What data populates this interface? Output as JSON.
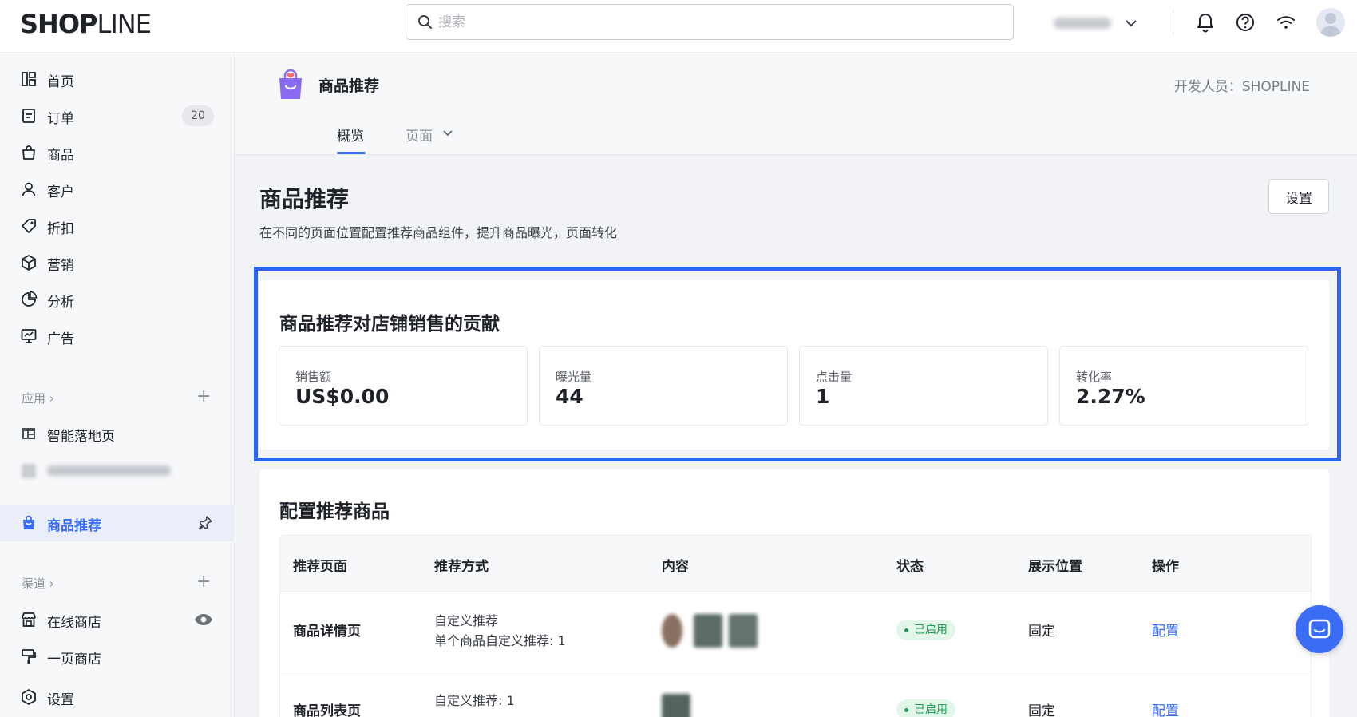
{
  "topbar": {
    "logo_bold": "SHOP",
    "logo_thin": "LINE",
    "search_placeholder": "搜索",
    "icons": [
      "search-icon",
      "chevron-down-icon",
      "bell-icon",
      "help-icon",
      "wifi-icon",
      "avatar"
    ]
  },
  "sidebar": {
    "items": [
      {
        "label": "首页",
        "icon": "home-icon"
      },
      {
        "label": "订单",
        "icon": "order-icon",
        "badge": "20"
      },
      {
        "label": "商品",
        "icon": "bag-icon"
      },
      {
        "label": "客户",
        "icon": "user-icon"
      },
      {
        "label": "折扣",
        "icon": "tag-icon"
      },
      {
        "label": "营销",
        "icon": "cube-icon"
      },
      {
        "label": "分析",
        "icon": "pie-chart-icon"
      },
      {
        "label": "广告",
        "icon": "ad-icon"
      }
    ],
    "apps_title": "应用",
    "apps": [
      {
        "label": "智能落地页",
        "icon": "layout-icon"
      },
      {
        "label": "商品推荐",
        "icon": "gift-bag-icon",
        "active": true
      }
    ],
    "channels_title": "渠道",
    "channels": [
      {
        "label": "在线商店",
        "icon": "store-icon"
      },
      {
        "label": "一页商店",
        "icon": "brush-icon"
      }
    ],
    "settings_label": "设置"
  },
  "app_header": {
    "title": "商品推荐",
    "developer": "开发人员：SHOPLINE",
    "tabs": [
      {
        "label": "概览",
        "active": true
      },
      {
        "label": "页面",
        "dropdown": true
      }
    ]
  },
  "page": {
    "title": "商品推荐",
    "description": "在不同的页面位置配置推荐商品组件，提升商品曝光，页面转化",
    "settings_button": "设置"
  },
  "contribution": {
    "title": "商品推荐对店铺销售的贡献",
    "stats": [
      {
        "label": "销售额",
        "value": "US$0.00"
      },
      {
        "label": "曝光量",
        "value": "44"
      },
      {
        "label": "点击量",
        "value": "1"
      },
      {
        "label": "转化率",
        "value": "2.27%"
      }
    ]
  },
  "config": {
    "title": "配置推荐商品",
    "columns": [
      "推荐页面",
      "推荐方式",
      "内容",
      "状态",
      "展示位置",
      "操作"
    ],
    "rows": [
      {
        "page": "商品详情页",
        "method": "自定义推荐",
        "method_detail": "单个商品自定义推荐: 1",
        "status": "已启用",
        "position": "固定",
        "action": "配置"
      },
      {
        "page": "商品列表页",
        "method": "自定义推荐: 1",
        "method_detail": "",
        "status": "已启用",
        "position": "固定",
        "action": "配置"
      }
    ]
  },
  "colors": {
    "accent": "#3b6cf5",
    "highlight": "#2f64f0",
    "success": "#1e9e57"
  }
}
